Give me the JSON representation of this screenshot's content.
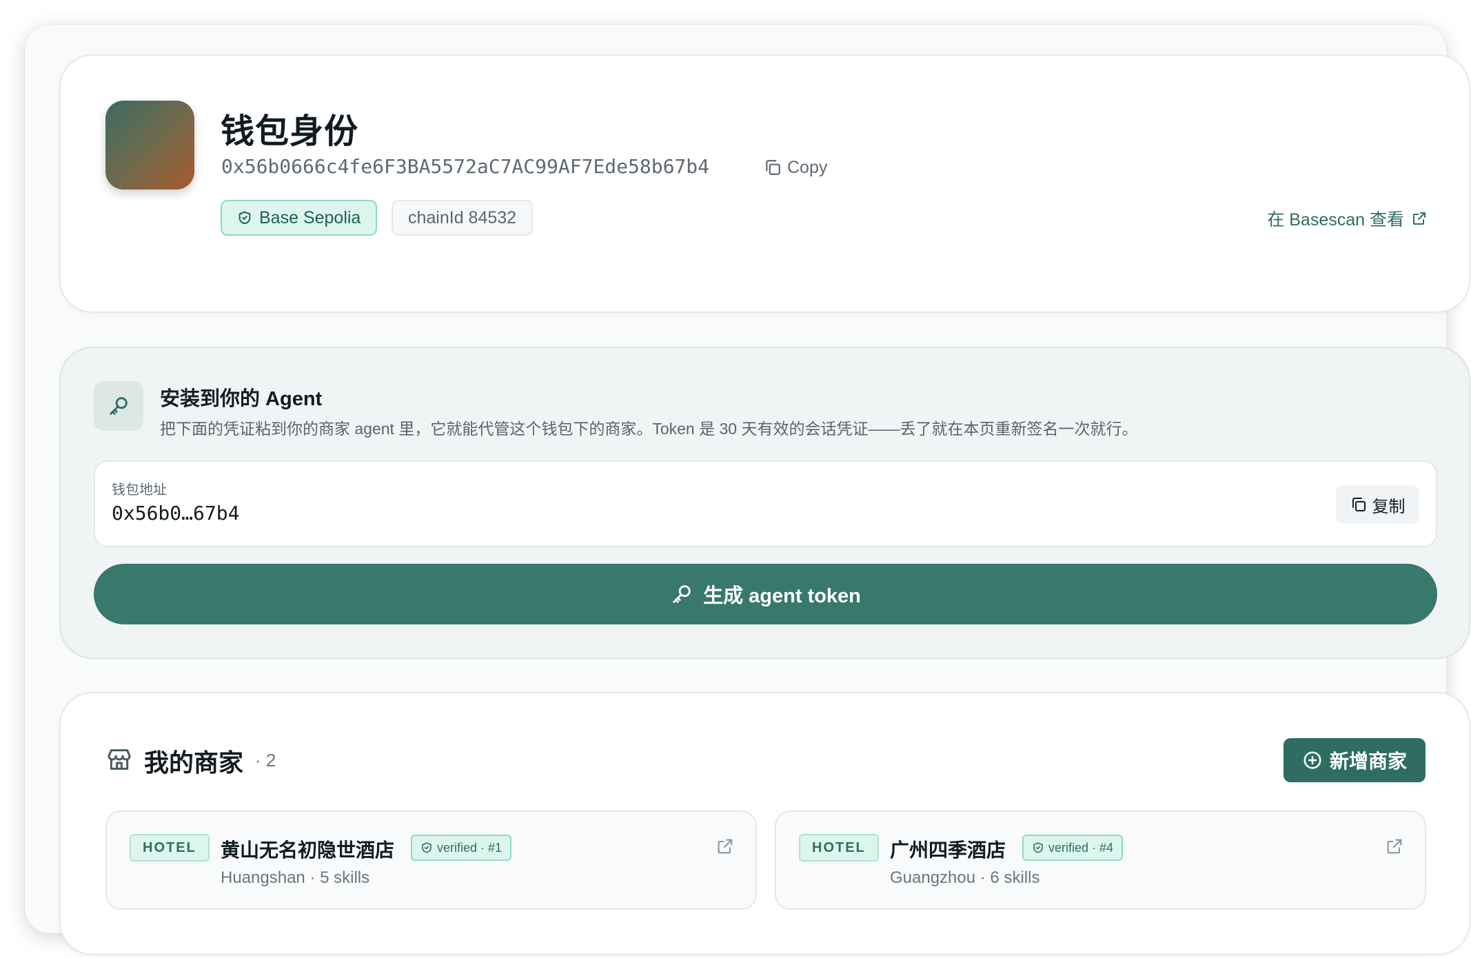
{
  "wallet": {
    "title": "钱包身份",
    "address": "0x56b0666c4fe6F3BA5572aC7AC99AF7Ede58b67b4",
    "copy_label": "Copy",
    "network_label": "Base Sepolia",
    "chain_label": "chainId 84532",
    "basescan_label": "在 Basescan 查看"
  },
  "agent": {
    "title": "安装到你的 Agent",
    "description": "把下面的凭证粘到你的商家 agent 里，它就能代管这个钱包下的商家。Token 是 30 天有效的会话凭证——丢了就在本页重新签名一次就行。",
    "address_label": "钱包地址",
    "address_short": "0x56b0…67b4",
    "copy_label": "复制",
    "generate_label": "生成 agent token"
  },
  "merchants": {
    "title": "我的商家",
    "count": "· 2",
    "add_label": "新增商家",
    "items": [
      {
        "type": "HOTEL",
        "name": "黄山无名初隐世酒店",
        "verified": "verified · #1",
        "meta": "Huangshan · 5 skills"
      },
      {
        "type": "HOTEL",
        "name": "广州四季酒店",
        "verified": "verified · #4",
        "meta": "Guangzhou · 6 skills"
      }
    ]
  },
  "icons": {
    "copy": "copy-icon",
    "shield": "shield-check-icon",
    "external": "external-link-icon",
    "key": "key-icon",
    "store": "store-icon",
    "plus_circle": "plus-circle-icon"
  },
  "colors": {
    "primary": "#38786d",
    "primary_dark": "#2f6d63",
    "badge_bg": "#dcf6ee",
    "badge_border": "#8fd9c3"
  }
}
